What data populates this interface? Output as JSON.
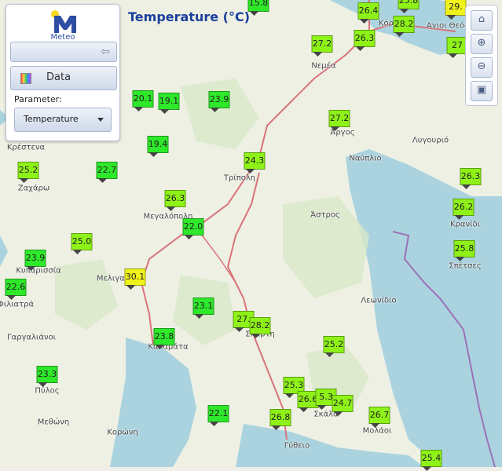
{
  "header": {
    "title": "Temperature (°C)"
  },
  "panel": {
    "logo_text": "Meteo",
    "data_label": "Data",
    "parameter_label": "Parameter:",
    "parameter_value": "Temperature"
  },
  "tools": {
    "icons": [
      "home-icon",
      "zoom-in-icon",
      "zoom-out-icon",
      "fit-extent-icon"
    ]
  },
  "legend_colors": {
    "green": "#2ee82a",
    "lime": "#8ef218",
    "yellow": "#f0f21a"
  },
  "places": [
    "Κόρινθος",
    "Αγιοι Θεόδ",
    "Νεμέα",
    "Άργος",
    "Λυγουριό",
    "Ναύπλιο",
    "Κρέστενα",
    "Ζαχάρω",
    "Τρίπολη",
    "Μεγαλόπολη",
    "Άστρος",
    "Κρανίδι",
    "Σπέτσες",
    "Κυπαρισσία",
    "Μελιγαλάς",
    "Φιλιατρά",
    "Λεωνίδιο",
    "Γαργαλιάνοι",
    "Καλαμάτα",
    "Σπάρτη",
    "Πύλος",
    "Μεθώνη",
    "Κορώνη",
    "Σκάλα",
    "Μολάοι",
    "Γύθειο"
  ],
  "stations": [
    {
      "label": "15.8",
      "color": "green"
    },
    {
      "label": "26.4",
      "color": "lime"
    },
    {
      "label": "25.8",
      "color": "lime"
    },
    {
      "label": "28.2",
      "color": "lime"
    },
    {
      "label": "29.",
      "color": "yellow"
    },
    {
      "label": "26.3",
      "color": "lime"
    },
    {
      "label": "27.2",
      "color": "lime"
    },
    {
      "label": "27",
      "color": "lime"
    },
    {
      "label": "20.1",
      "color": "green"
    },
    {
      "label": "19.1",
      "color": "green"
    },
    {
      "label": "23.9",
      "color": "green"
    },
    {
      "label": "27.2",
      "color": "lime"
    },
    {
      "label": "19.4",
      "color": "green"
    },
    {
      "label": "24.3",
      "color": "lime"
    },
    {
      "label": "25.2",
      "color": "lime"
    },
    {
      "label": "22.7",
      "color": "green"
    },
    {
      "label": "26.3",
      "color": "lime"
    },
    {
      "label": "26.3",
      "color": "lime"
    },
    {
      "label": "26.2",
      "color": "lime"
    },
    {
      "label": "22.0",
      "color": "green"
    },
    {
      "label": "25.0",
      "color": "lime"
    },
    {
      "label": "25.8",
      "color": "lime"
    },
    {
      "label": "23.9",
      "color": "green"
    },
    {
      "label": "30.1",
      "color": "yellow"
    },
    {
      "label": "22.6",
      "color": "green"
    },
    {
      "label": "23.1",
      "color": "green"
    },
    {
      "label": "27.",
      "color": "lime"
    },
    {
      "label": "28.2",
      "color": "lime"
    },
    {
      "label": "23.8",
      "color": "green"
    },
    {
      "label": "25.2",
      "color": "lime"
    },
    {
      "label": "23.3",
      "color": "green"
    },
    {
      "label": "25.3",
      "color": "lime"
    },
    {
      "label": "26.6",
      "color": "lime"
    },
    {
      "label": "5.3",
      "color": "lime"
    },
    {
      "label": "24.7",
      "color": "lime"
    },
    {
      "label": "22.1",
      "color": "green"
    },
    {
      "label": "26.8",
      "color": "lime"
    },
    {
      "label": "26.7",
      "color": "lime"
    },
    {
      "label": "25.4",
      "color": "lime"
    }
  ]
}
